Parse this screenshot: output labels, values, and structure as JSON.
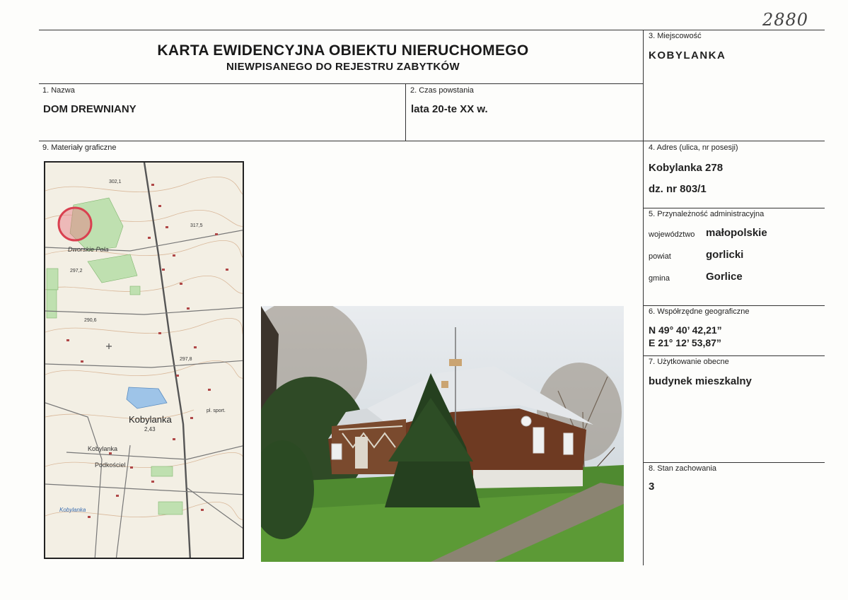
{
  "handwritten_number": "2880",
  "header": {
    "title": "KARTA EWIDENCYJNA OBIEKTU NIERUCHOMEGO",
    "subtitle": "NIEWPISANEGO DO REJESTRU ZABYTKÓW"
  },
  "fields": {
    "nazwa": {
      "label": "1. Nazwa",
      "value": "DOM DREWNIANY"
    },
    "czas": {
      "label": "2. Czas powstania",
      "value": "lata 20-te XX w."
    },
    "miejscowosc": {
      "label": "3. Miejscowość",
      "value": "KOBYLANKA"
    },
    "adres": {
      "label": "4. Adres (ulica, nr posesji)",
      "line1": "Kobylanka 278",
      "line2": "dz. nr 803/1"
    },
    "przynaleznosc": {
      "label": "5. Przynależność administracyjna",
      "wojewodztwo_label": "województwo",
      "wojewodztwo": "małopolskie",
      "powiat_label": "powiat",
      "powiat": "gorlicki",
      "gmina_label": "gmina",
      "gmina": "Gorlice"
    },
    "wspolrzedne": {
      "label": "6. Współrzędne geograficzne",
      "n": "N 49° 40’ 42,21”",
      "e": "E 21° 12’ 53,87”"
    },
    "uzytkowanie": {
      "label": "7. Użytkowanie obecne",
      "value": "budynek mieszkalny"
    },
    "stan": {
      "label": "8. Stan zachowania",
      "value": "3"
    },
    "materialy": {
      "label": "9. Materiały graficzne"
    }
  },
  "map": {
    "labels": {
      "dworskie_pola": "Dworskie Pola",
      "kobylanka": "Kobylanka",
      "kobylanka_small": "Kobylanka",
      "podkoscie": "Podkościel",
      "kobylanka_bottom": "Kobylanka",
      "pl_sport": "pl. sport.",
      "elev1": "2,43",
      "elev2": "317,5",
      "elev3": "302,1",
      "elev4": "290,6",
      "elev5": "297,8",
      "elev6": "297,2"
    }
  }
}
